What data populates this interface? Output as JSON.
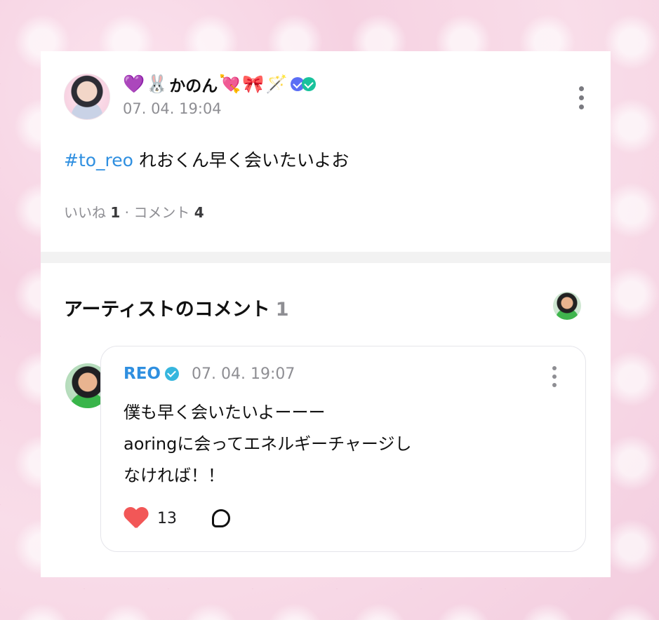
{
  "post": {
    "user_name": "かのん",
    "emoji_before": [
      "💜",
      "🐰"
    ],
    "emoji_after": [
      "💘",
      "🎀",
      "🪄"
    ],
    "timestamp": "07. 04. 19:04",
    "hashtag": "#to_reo",
    "text": " れおくん早く会いたいよお",
    "likes_label": "いいね",
    "likes_count": "1",
    "separator": "·",
    "comments_label": "コメント",
    "comments_count": "4"
  },
  "artist_comments": {
    "heading": "アーティストのコメント",
    "count": "1",
    "comment": {
      "author": "REO",
      "timestamp": "07. 04. 19:07",
      "lines": [
        "僕も早く会いたいよーーー",
        "aoringに会ってエネルギーチャージし",
        "なければ！！"
      ],
      "like_count": "13"
    }
  },
  "colors": {
    "hashtag": "#2f8fe0",
    "artist_name": "#2f8fe0",
    "heart": "#f25757",
    "verified": "#36b6de"
  },
  "icons": [
    "kebab-menu-icon",
    "verified-badge-icon",
    "heart-icon",
    "reply-bubble-icon",
    "badge-icons"
  ]
}
